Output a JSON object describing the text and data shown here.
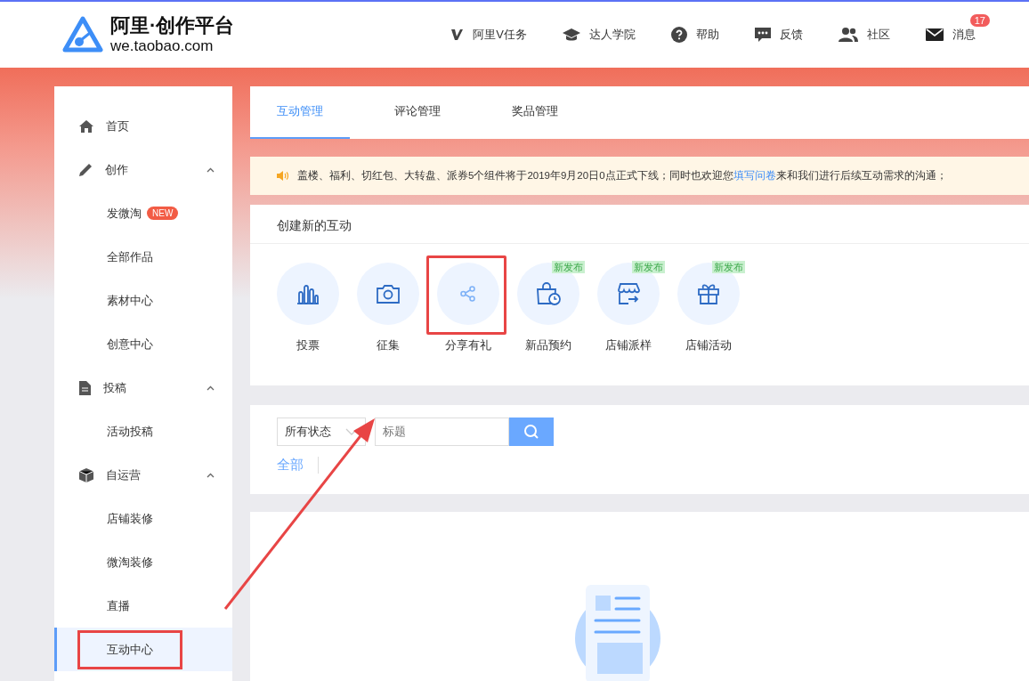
{
  "header": {
    "logo_title": "阿里·创作平台",
    "logo_subtitle": "we.taobao.com",
    "nav": [
      {
        "label": "阿里V任务"
      },
      {
        "label": "达人学院"
      },
      {
        "label": "帮助"
      },
      {
        "label": "反馈"
      },
      {
        "label": "社区"
      },
      {
        "label": "消息",
        "badge": "17"
      }
    ]
  },
  "sidebar": {
    "items": [
      {
        "kind": "link",
        "label": "首页",
        "selected": false,
        "highlighted": false
      },
      {
        "kind": "group",
        "label": "创作",
        "expanded": true,
        "children": [
          {
            "label": "发微淘",
            "badge": "NEW",
            "selected": false,
            "highlighted": false
          },
          {
            "label": "全部作品",
            "selected": false,
            "highlighted": false
          },
          {
            "label": "素材中心",
            "selected": false,
            "highlighted": false
          },
          {
            "label": "创意中心",
            "selected": false,
            "highlighted": false
          }
        ]
      },
      {
        "kind": "group",
        "label": "投稿",
        "expanded": true,
        "children": [
          {
            "label": "活动投稿",
            "selected": false,
            "highlighted": false
          }
        ]
      },
      {
        "kind": "group",
        "label": "自运营",
        "expanded": true,
        "children": [
          {
            "label": "店铺装修",
            "selected": false,
            "highlighted": false
          },
          {
            "label": "微淘装修",
            "selected": false,
            "highlighted": false
          },
          {
            "label": "直播",
            "selected": false,
            "highlighted": false
          },
          {
            "label": "互动中心",
            "selected": true,
            "highlighted": true
          }
        ]
      }
    ]
  },
  "tabs": [
    {
      "label": "互动管理",
      "selected": true
    },
    {
      "label": "评论管理",
      "selected": false
    },
    {
      "label": "奖品管理",
      "selected": false
    }
  ],
  "notice": {
    "text_before": "盖楼、福利、切红包、大转盘、派券5个组件将于2019年9月20日0点正式下线；同时也欢迎您",
    "link": "填写问卷",
    "text_after": "来和我们进行后续互动需求的沟通；"
  },
  "create": {
    "title": "创建新的互动",
    "items": [
      {
        "label": "投票",
        "highlighted": false
      },
      {
        "label": "征集",
        "highlighted": false
      },
      {
        "label": "分享有礼",
        "highlighted": true
      },
      {
        "label": "新品预约",
        "tag": "新发布",
        "highlighted": false
      },
      {
        "label": "店铺派样",
        "tag": "新发布",
        "highlighted": false
      },
      {
        "label": "店铺活动",
        "tag": "新发布",
        "highlighted": false
      }
    ]
  },
  "filter": {
    "status_select": "所有状态",
    "search": {
      "placeholder": "标题"
    },
    "status_tabs": [
      {
        "label": "全部",
        "selected": true
      }
    ]
  }
}
